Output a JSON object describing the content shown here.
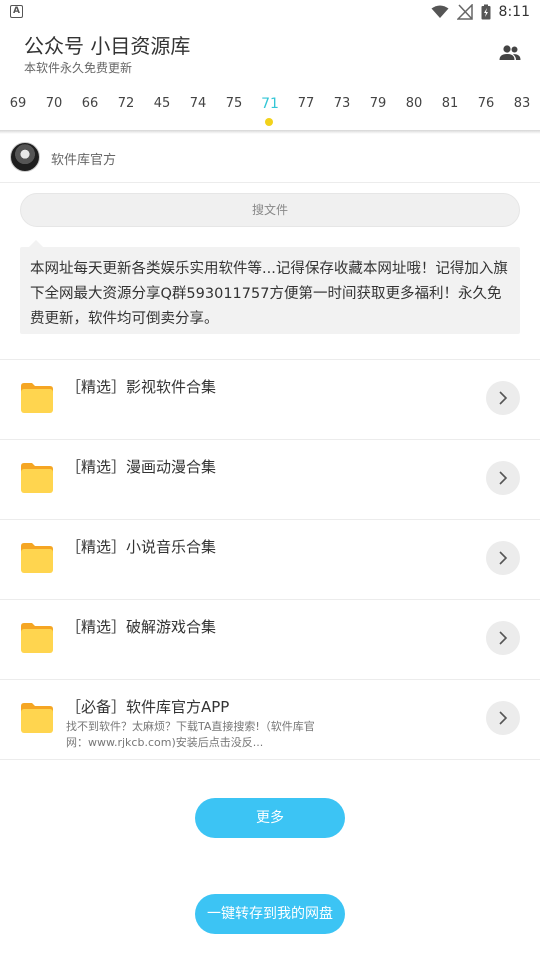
{
  "status_bar": {
    "left_icon": "A",
    "time": "8:11",
    "icons": [
      "wifi-icon",
      "no-signal-icon",
      "battery-icon"
    ]
  },
  "header": {
    "title": "公众号 小目资源库",
    "subtitle": "本软件永久免费更新",
    "right_icon": "people-icon"
  },
  "tabs": [
    {
      "label": "69",
      "active": false
    },
    {
      "label": "70",
      "active": false
    },
    {
      "label": "66",
      "active": false
    },
    {
      "label": "72",
      "active": false
    },
    {
      "label": "45",
      "active": false
    },
    {
      "label": "74",
      "active": false
    },
    {
      "label": "75",
      "active": false
    },
    {
      "label": "71",
      "active": true
    },
    {
      "label": "77",
      "active": false
    },
    {
      "label": "73",
      "active": false
    },
    {
      "label": "79",
      "active": false
    },
    {
      "label": "80",
      "active": false
    },
    {
      "label": "81",
      "active": false
    },
    {
      "label": "76",
      "active": false
    },
    {
      "label": "83",
      "active": false
    }
  ],
  "author": {
    "name": "软件库官方"
  },
  "search": {
    "placeholder": "搜文件"
  },
  "notice": {
    "text": "本网址每天更新各类娱乐实用软件等...记得保存收藏本网址哦！记得加入旗下全网最大资源分享Q群593011757方便第一时间获取更多福利！永久免费更新，软件均可倒卖分享。"
  },
  "items": [
    {
      "title": "［精选］影视软件合集",
      "desc": ""
    },
    {
      "title": "［精选］漫画动漫合集",
      "desc": ""
    },
    {
      "title": "［精选］小说音乐合集",
      "desc": ""
    },
    {
      "title": "［精选］破解游戏合集",
      "desc": ""
    },
    {
      "title": "［必备］软件库官方APP",
      "desc": "找不到软件？太麻烦？下载TA直接搜索!（软件库官网：www.rjkcb.com)安装后点击没反..."
    }
  ],
  "buttons": {
    "more": "更多",
    "save": "一键转存到我的网盘"
  },
  "colors": {
    "accent": "#3cc4f4",
    "active_tab": "#33c6d6",
    "indicator_dot": "#f2d21b",
    "folder": "#ffd54f"
  }
}
